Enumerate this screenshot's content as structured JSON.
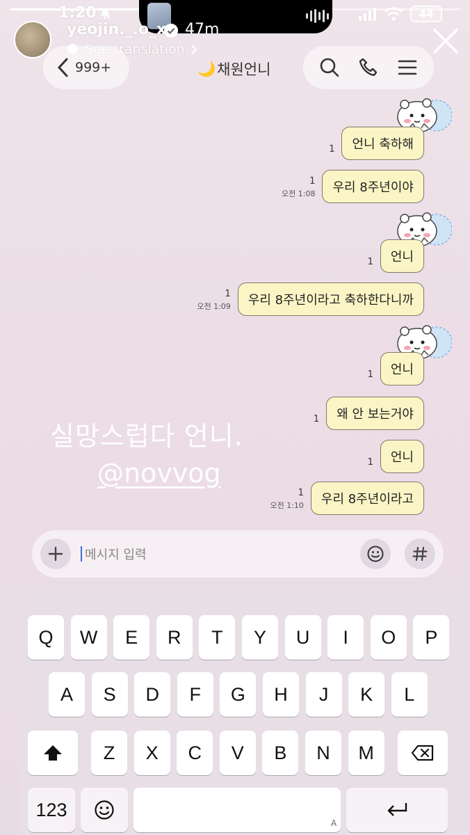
{
  "status_bar": {
    "time": "1:20",
    "battery": "44"
  },
  "story": {
    "username": "yeojin._.o_x",
    "age": "47m",
    "translate": "See translation",
    "text_overlay": "실망스럽다 언니.",
    "mention": "@novvog"
  },
  "chat_header": {
    "back_count": "999+",
    "title_emoji": "🌙",
    "title": "채원언니"
  },
  "messages": [
    {
      "text": "언니 축하해",
      "unread": "1",
      "time": "",
      "sticker": true
    },
    {
      "text": "우리 8주년이야",
      "unread": "1",
      "time": "오전 1:08",
      "sticker": false
    },
    {
      "text": "언니",
      "unread": "1",
      "time": "",
      "sticker": true
    },
    {
      "text": "우리 8주년이라고 축하한다니까",
      "unread": "1",
      "time": "오전 1:09",
      "sticker": false
    },
    {
      "text": "언니",
      "unread": "1",
      "time": "",
      "sticker": true
    },
    {
      "text": "왜 안 보는거야",
      "unread": "1",
      "time": "",
      "sticker": false
    },
    {
      "text": "언니",
      "unread": "1",
      "time": "",
      "sticker": false
    },
    {
      "text": "우리 8주년이라고",
      "unread": "1",
      "time": "오전 1:10",
      "sticker": false
    }
  ],
  "input": {
    "placeholder": "메시지 입력"
  },
  "keyboard": {
    "row1": [
      "Q",
      "W",
      "E",
      "R",
      "T",
      "Y",
      "U",
      "I",
      "O",
      "P"
    ],
    "row2": [
      "A",
      "S",
      "D",
      "F",
      "G",
      "H",
      "J",
      "K",
      "L"
    ],
    "row3": [
      "Z",
      "X",
      "C",
      "V",
      "B",
      "N",
      "M"
    ],
    "numbers_key": "123",
    "space_indicator": "A"
  },
  "colors": {
    "bubble": "#fbf5c6",
    "bubble_border": "#7d7a6a",
    "background": "#ecdde6"
  }
}
